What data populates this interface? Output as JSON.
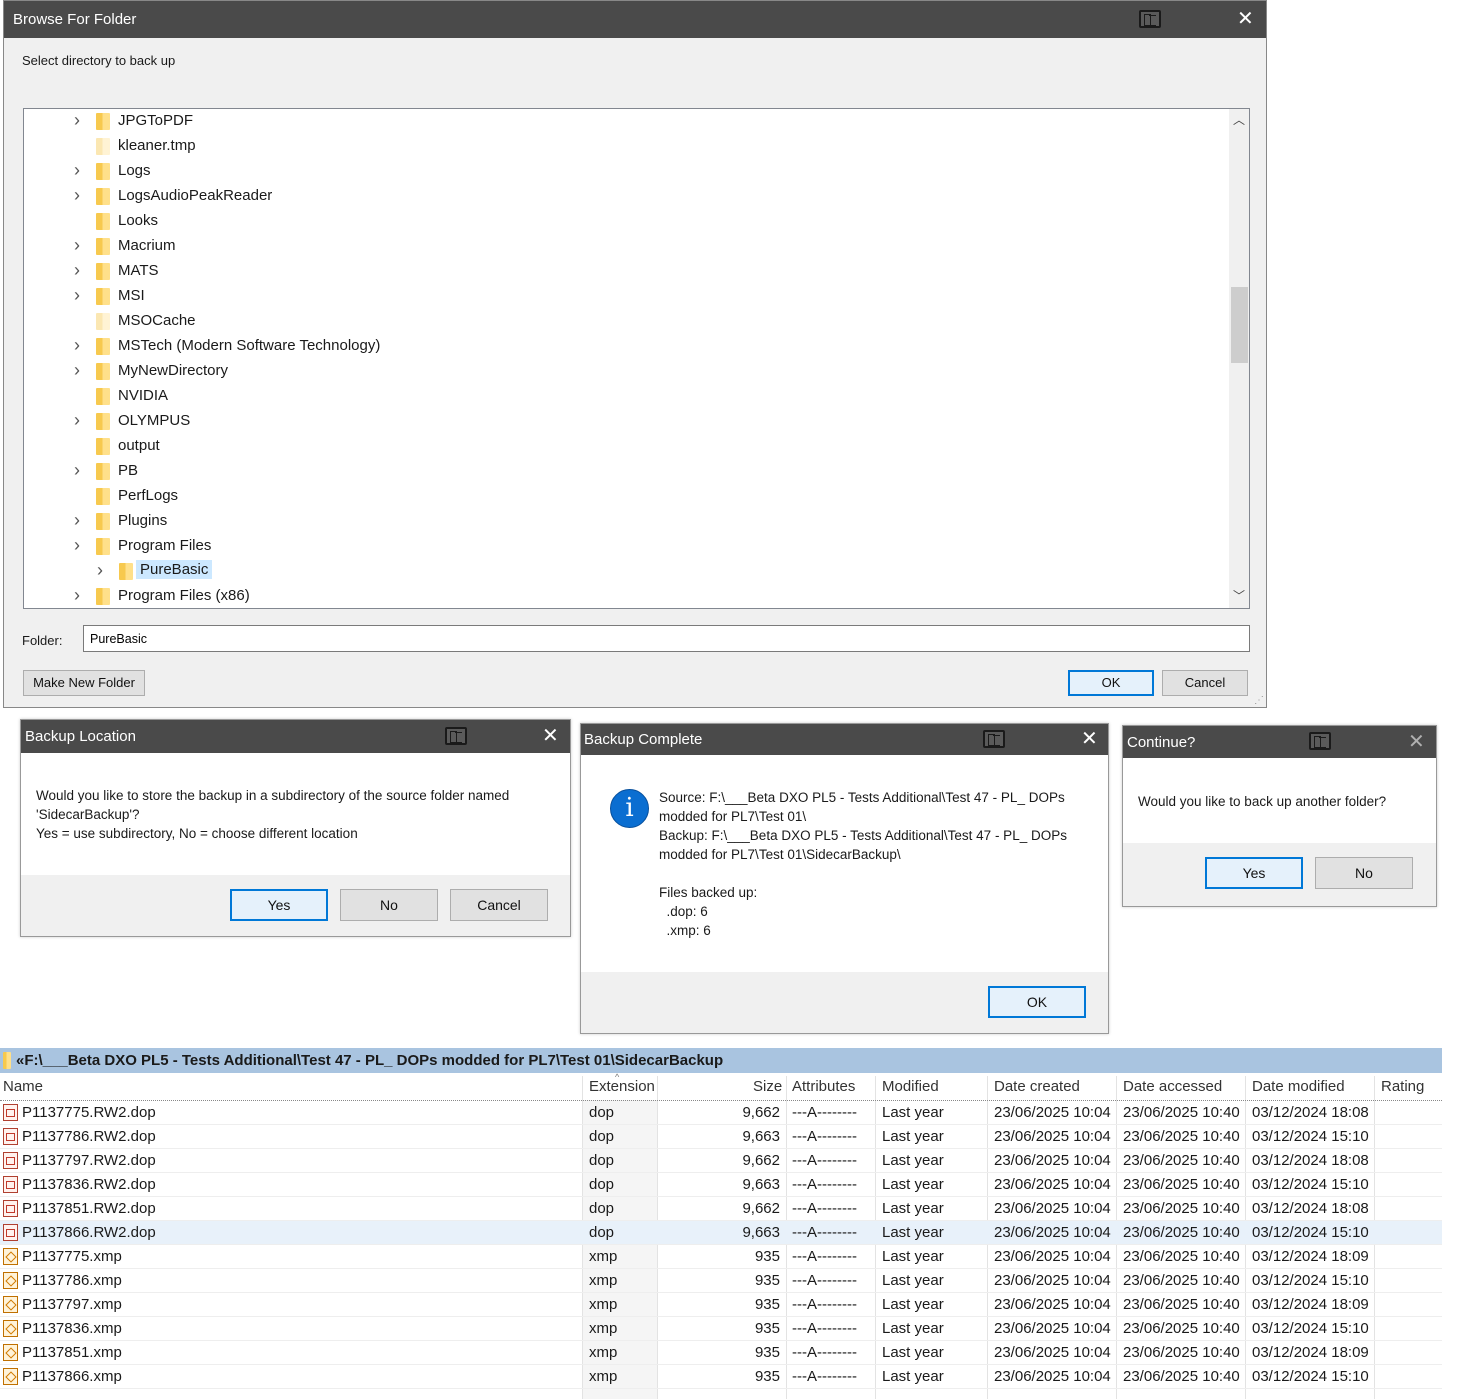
{
  "browse": {
    "title": "Browse For Folder",
    "prompt": "Select directory to back up",
    "tree": [
      {
        "label": "JPGToPDF",
        "expandable": true
      },
      {
        "label": "kleaner.tmp",
        "expandable": false,
        "light": true
      },
      {
        "label": "Logs",
        "expandable": true
      },
      {
        "label": "LogsAudioPeakReader",
        "expandable": true
      },
      {
        "label": "Looks",
        "expandable": false
      },
      {
        "label": "Macrium",
        "expandable": true
      },
      {
        "label": "MATS",
        "expandable": true
      },
      {
        "label": "MSI",
        "expandable": true
      },
      {
        "label": "MSOCache",
        "expandable": false,
        "light": true
      },
      {
        "label": "MSTech (Modern Software Technology)",
        "expandable": true
      },
      {
        "label": "MyNewDirectory",
        "expandable": true
      },
      {
        "label": "NVIDIA",
        "expandable": false
      },
      {
        "label": "OLYMPUS",
        "expandable": true
      },
      {
        "label": "output",
        "expandable": false
      },
      {
        "label": "PB",
        "expandable": true
      },
      {
        "label": "PerfLogs",
        "expandable": false
      },
      {
        "label": "Plugins",
        "expandable": true
      },
      {
        "label": "Program Files",
        "expandable": true
      },
      {
        "label": "PureBasic",
        "expandable": true,
        "child": true,
        "selected": true
      },
      {
        "label": "Program Files (x86)",
        "expandable": true
      }
    ],
    "folder_label": "Folder:",
    "folder_value": "PureBasic",
    "make_new_folder": "Make New Folder",
    "ok": "OK",
    "cancel": "Cancel"
  },
  "backup_location": {
    "title": "Backup Location",
    "message": "Would you like to store the backup in a subdirectory of the source folder named\n'SidecarBackup'?\nYes = use subdirectory, No = choose different location",
    "yes": "Yes",
    "no": "No",
    "cancel": "Cancel"
  },
  "backup_complete": {
    "title": "Backup Complete",
    "message": "Source: F:\\___Beta DXO PL5 - Tests Additional\\Test 47 - PL_ DOPs\nmodded for PL7\\Test 01\\\nBackup: F:\\___Beta DXO PL5 - Tests Additional\\Test 47 - PL_ DOPs\nmodded for PL7\\Test 01\\SidecarBackup\\\n\nFiles backed up:\n  .dop: 6\n  .xmp: 6",
    "info_glyph": "i",
    "ok": "OK"
  },
  "continue": {
    "title": "Continue?",
    "message": "Would you like to back up another folder?",
    "yes": "Yes",
    "no": "No"
  },
  "explorer": {
    "path": "«F:\\___Beta DXO PL5 - Tests Additional\\Test 47 - PL_ DOPs modded for PL7\\Test 01\\SidecarBackup",
    "columns": [
      "Name",
      "Extension",
      "Size",
      "Attributes",
      "Modified",
      "Date created",
      "Date accessed",
      "Date modified",
      "Rating"
    ],
    "rows": [
      {
        "name": "P1137775.RW2.dop",
        "ext": "dop",
        "size": "9,662",
        "attr": "---A--------",
        "modified": "Last year",
        "created": "23/06/2025 10:04",
        "accessed": "23/06/2025 10:40",
        "dmod": "03/12/2024 18:08",
        "type": "dop"
      },
      {
        "name": "P1137786.RW2.dop",
        "ext": "dop",
        "size": "9,663",
        "attr": "---A--------",
        "modified": "Last year",
        "created": "23/06/2025 10:04",
        "accessed": "23/06/2025 10:40",
        "dmod": "03/12/2024 15:10",
        "type": "dop"
      },
      {
        "name": "P1137797.RW2.dop",
        "ext": "dop",
        "size": "9,662",
        "attr": "---A--------",
        "modified": "Last year",
        "created": "23/06/2025 10:04",
        "accessed": "23/06/2025 10:40",
        "dmod": "03/12/2024 18:08",
        "type": "dop"
      },
      {
        "name": "P1137836.RW2.dop",
        "ext": "dop",
        "size": "9,663",
        "attr": "---A--------",
        "modified": "Last year",
        "created": "23/06/2025 10:04",
        "accessed": "23/06/2025 10:40",
        "dmod": "03/12/2024 15:10",
        "type": "dop"
      },
      {
        "name": "P1137851.RW2.dop",
        "ext": "dop",
        "size": "9,662",
        "attr": "---A--------",
        "modified": "Last year",
        "created": "23/06/2025 10:04",
        "accessed": "23/06/2025 10:40",
        "dmod": "03/12/2024 18:08",
        "type": "dop"
      },
      {
        "name": "P1137866.RW2.dop",
        "ext": "dop",
        "size": "9,663",
        "attr": "---A--------",
        "modified": "Last year",
        "created": "23/06/2025 10:04",
        "accessed": "23/06/2025 10:40",
        "dmod": "03/12/2024 15:10",
        "type": "dop",
        "highlight": true
      },
      {
        "name": "P1137775.xmp",
        "ext": "xmp",
        "size": "935",
        "attr": "---A--------",
        "modified": "Last year",
        "created": "23/06/2025 10:04",
        "accessed": "23/06/2025 10:40",
        "dmod": "03/12/2024 18:09",
        "type": "xmp"
      },
      {
        "name": "P1137786.xmp",
        "ext": "xmp",
        "size": "935",
        "attr": "---A--------",
        "modified": "Last year",
        "created": "23/06/2025 10:04",
        "accessed": "23/06/2025 10:40",
        "dmod": "03/12/2024 15:10",
        "type": "xmp"
      },
      {
        "name": "P1137797.xmp",
        "ext": "xmp",
        "size": "935",
        "attr": "---A--------",
        "modified": "Last year",
        "created": "23/06/2025 10:04",
        "accessed": "23/06/2025 10:40",
        "dmod": "03/12/2024 18:09",
        "type": "xmp"
      },
      {
        "name": "P1137836.xmp",
        "ext": "xmp",
        "size": "935",
        "attr": "---A--------",
        "modified": "Last year",
        "created": "23/06/2025 10:04",
        "accessed": "23/06/2025 10:40",
        "dmod": "03/12/2024 15:10",
        "type": "xmp"
      },
      {
        "name": "P1137851.xmp",
        "ext": "xmp",
        "size": "935",
        "attr": "---A--------",
        "modified": "Last year",
        "created": "23/06/2025 10:04",
        "accessed": "23/06/2025 10:40",
        "dmod": "03/12/2024 18:09",
        "type": "xmp"
      },
      {
        "name": "P1137866.xmp",
        "ext": "xmp",
        "size": "935",
        "attr": "---A--------",
        "modified": "Last year",
        "created": "23/06/2025 10:04",
        "accessed": "23/06/2025 10:40",
        "dmod": "03/12/2024 15:10",
        "type": "xmp"
      }
    ]
  },
  "colors": {
    "title_bar": "#4a4a4a",
    "default_button_border": "#0078d7",
    "path_bar": "#a9c4e0",
    "selection": "#cce8ff",
    "info_icon": "#0a6ed1"
  }
}
